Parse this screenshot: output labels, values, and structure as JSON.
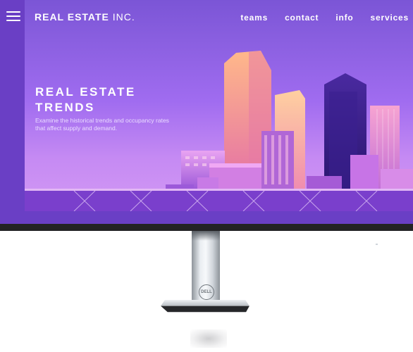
{
  "window": {
    "brand_bold": "REAL ESTATE",
    "brand_light": "INC."
  },
  "nav": {
    "items": [
      "teams",
      "contact",
      "info",
      "services"
    ]
  },
  "hero": {
    "title": "REAL ESTATE TRENDS",
    "subtitle": "Examine the historical trends and occupancy rates that affect supply and demand."
  },
  "stand": {
    "logo": "DELL"
  },
  "colors": {
    "sidebar": "#6a3fc5",
    "accent": "#a06cf0",
    "text": "#ffffff"
  },
  "icons": {
    "menu": "hamburger-menu-icon",
    "logo": "dell-logo-icon"
  }
}
